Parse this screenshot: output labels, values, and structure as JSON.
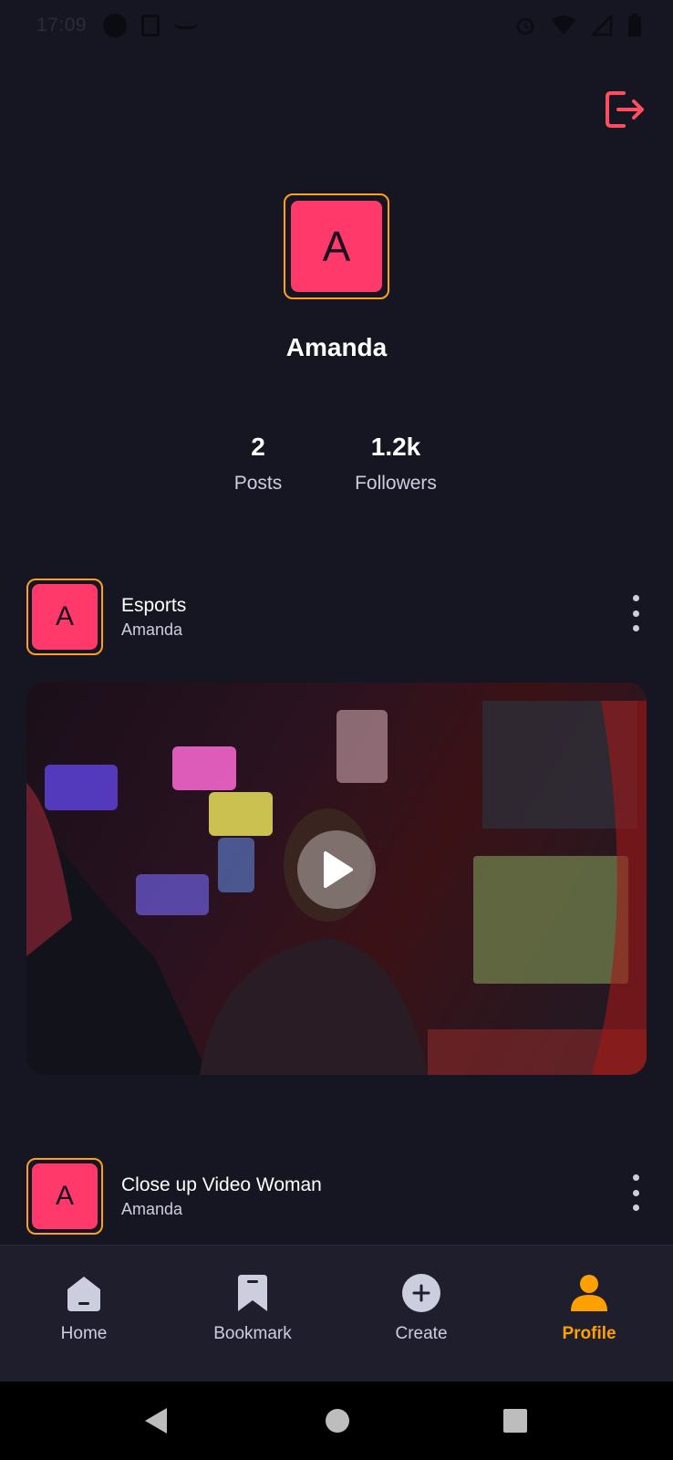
{
  "status_bar": {
    "time": "17:09"
  },
  "profile": {
    "avatar_letter": "A",
    "name": "Amanda",
    "stats": {
      "posts_value": "2",
      "posts_label": "Posts",
      "followers_value": "1.2k",
      "followers_label": "Followers"
    }
  },
  "posts": [
    {
      "avatar_letter": "A",
      "title": "Esports",
      "author": "Amanda"
    },
    {
      "avatar_letter": "A",
      "title": "Close up Video Woman",
      "author": "Amanda"
    }
  ],
  "bottom_nav": {
    "items": [
      {
        "label": "Home",
        "icon": "home-icon"
      },
      {
        "label": "Bookmark",
        "icon": "bookmark-icon"
      },
      {
        "label": "Create",
        "icon": "plus-circle-icon"
      },
      {
        "label": "Profile",
        "icon": "profile-icon",
        "active": true
      }
    ]
  },
  "colors": {
    "background": "#161622",
    "accent": "#ffa001",
    "avatar_fill": "#ff3a6a",
    "logout": "#ff4d61"
  }
}
